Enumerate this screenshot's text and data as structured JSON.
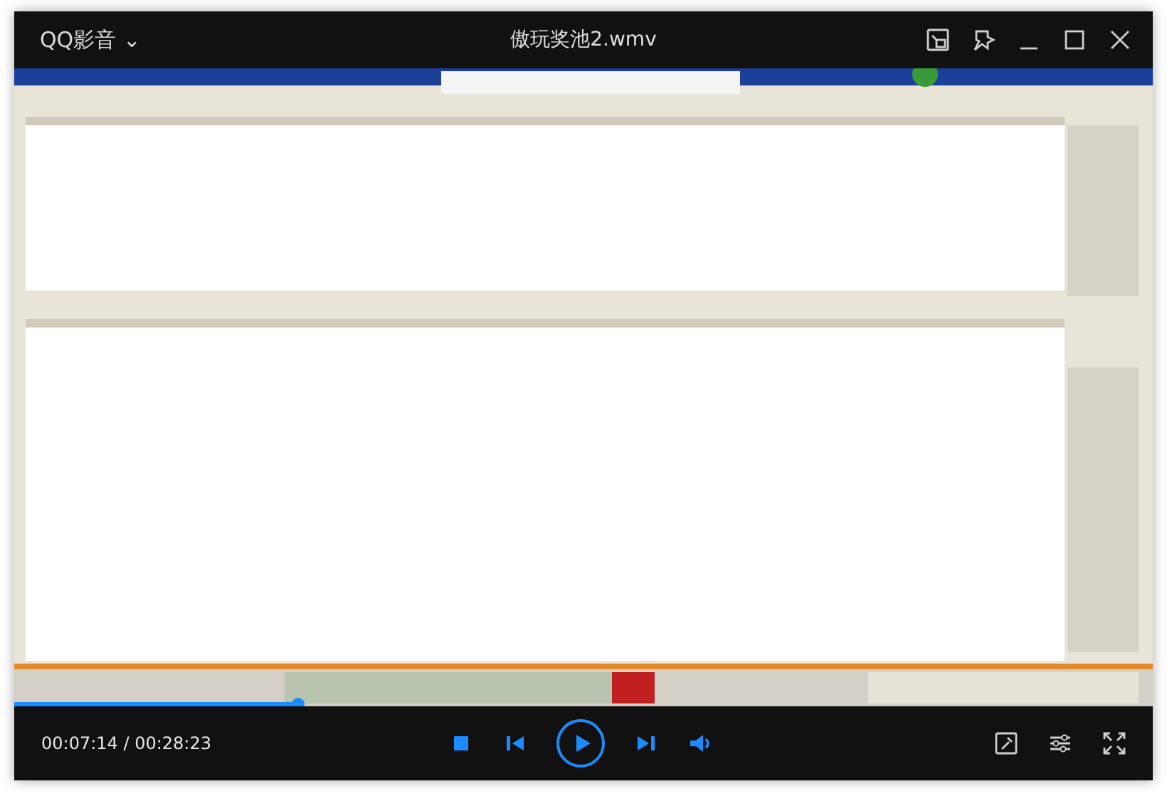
{
  "app": {
    "name": "QQ影音",
    "menu_caret": "⌄"
  },
  "window": {
    "title": "傲玩奖池2.wmv"
  },
  "playback": {
    "level": 0.25,
    "time": "00:07:14 / 00:28:23",
    "playing": false
  }
}
